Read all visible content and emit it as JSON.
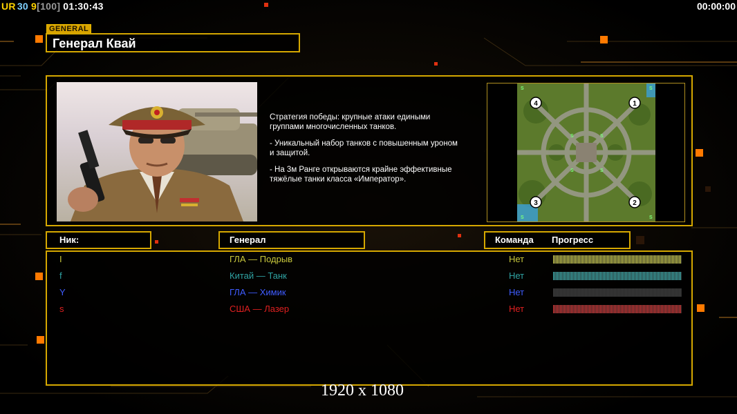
{
  "hud": {
    "tag": "UR",
    "fps": "30",
    "players": "9",
    "ping": "[100]",
    "clock": "01:30:43",
    "timer": "00:00:00"
  },
  "general": {
    "tag": "GENERAL",
    "name": "Генерал Квай"
  },
  "description": [
    "Стратегия победы: крупные атаки едиными\n группами многочисленных танков.",
    "- Уникальный набор танков с повышенным уроном\n и защитой.",
    "- На 3м Ранге открываются крайне эффективные\n тяжёлые танки класса «Император»."
  ],
  "map": {
    "start_positions": [
      "4",
      "1",
      "3",
      "2"
    ],
    "supply_marker": "S"
  },
  "columns": {
    "nick": "Ник:",
    "general": "Генерал",
    "team": "Команда",
    "progress": "Прогресс"
  },
  "players": [
    {
      "nick": "I",
      "general": "ГЛА — Подрыв",
      "team": "Нет",
      "progress": 1.0,
      "color": "#c8c83c",
      "bar_color": "#d8d84a"
    },
    {
      "nick": "f",
      "general": "Китай — Танк",
      "team": "Нет",
      "progress": 1.0,
      "color": "#2fa3a3",
      "bar_color": "#38b8b8"
    },
    {
      "nick": "Y",
      "general": "ГЛА — Химик",
      "team": "Нет",
      "progress": 0.0,
      "color": "#3f5cff",
      "bar_color": "#3a3a3a"
    },
    {
      "nick": "s",
      "general": "США — Лазер",
      "team": "Нет",
      "progress": 1.0,
      "color": "#e02020",
      "bar_color": "#e03030"
    }
  ],
  "resolution_label": "1920 x 1080",
  "colors": {
    "accent": "#d6a800",
    "hud_tag": "#ffd400",
    "hud_fps": "#7fd0ff",
    "hud_ping": "#9a9a9a",
    "decor_orange": "#ff7a00"
  }
}
